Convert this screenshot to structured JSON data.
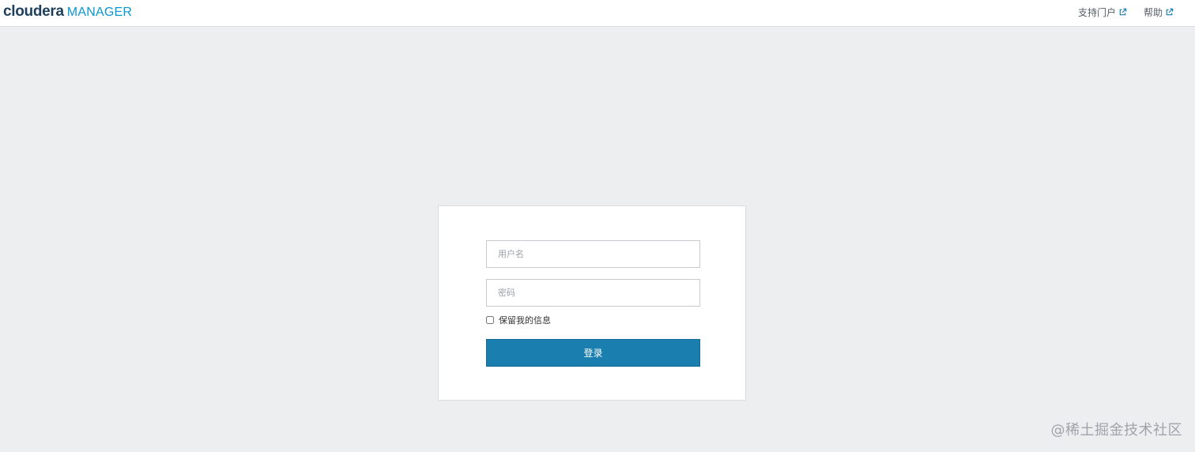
{
  "header": {
    "logo_primary": "cloudera",
    "logo_secondary": "MANAGER",
    "nav": [
      {
        "label": "支持门户",
        "icon": "external-link-icon"
      },
      {
        "label": "帮助",
        "icon": "external-link-icon"
      }
    ]
  },
  "login": {
    "username_placeholder": "用户名",
    "password_placeholder": "密码",
    "remember_label": "保留我的信息",
    "remember_checked": false,
    "submit_label": "登录"
  },
  "watermark": "@稀土掘金技术社区",
  "colors": {
    "background": "#eceef0",
    "primary_button": "#1a7fae",
    "logo_dark": "#1d3f5c",
    "logo_accent": "#0a96cf",
    "link_icon": "#1a7fae"
  }
}
